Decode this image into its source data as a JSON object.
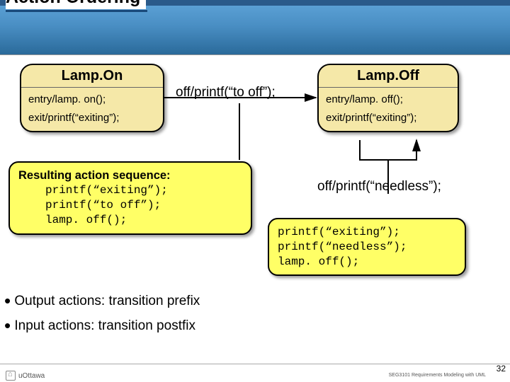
{
  "header": {
    "title": "Action Ordering"
  },
  "state_on": {
    "title": "Lamp.On",
    "entry": "entry/lamp. on();",
    "exit": "exit/printf(“exiting”);"
  },
  "state_off": {
    "title": "Lamp.Off",
    "entry": "entry/lamp. off();",
    "exit": "exit/printf(“exiting”);"
  },
  "transitions": {
    "to_off": "off/printf(“to off”);",
    "self": "off/printf(“needless”);"
  },
  "callout1": {
    "heading": "Resulting action sequence:",
    "lines": [
      "printf(“exiting”);",
      "printf(“to off”);",
      "lamp. off();"
    ]
  },
  "callout2": {
    "lines": [
      "printf(“exiting”);",
      "printf(“needless”);",
      "lamp. off();"
    ]
  },
  "bullets": {
    "b1": "Output actions: transition prefix",
    "b2": "Input actions: transition postfix"
  },
  "footer": {
    "course": "SEG3101  Requirements Modeling with UML",
    "page": "32",
    "org": "uOttawa"
  }
}
